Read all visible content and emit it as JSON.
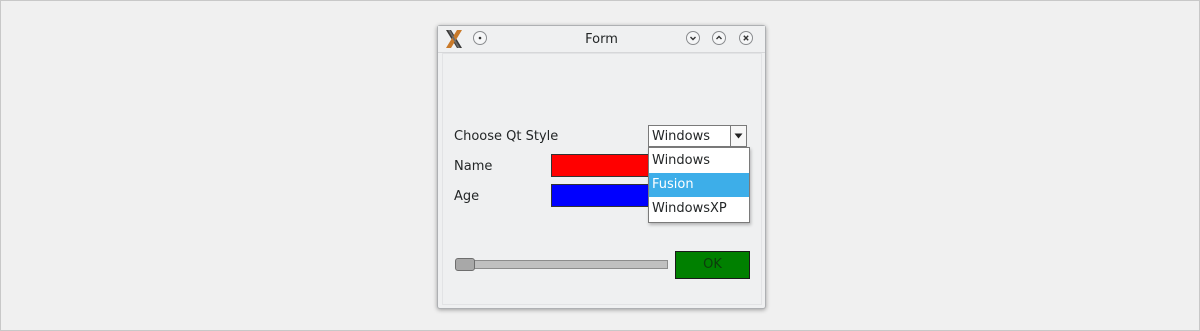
{
  "window": {
    "title": "Form"
  },
  "form": {
    "style_label": "Choose Qt Style",
    "style_combo": {
      "selected": "Windows",
      "options": [
        "Windows",
        "Fusion",
        "WindowsXP"
      ],
      "highlighted": "Fusion"
    },
    "name_label": "Name",
    "age_label": "Age",
    "name_field_color": "#ff0000",
    "age_field_color": "#0000ff",
    "slider_value_percent": 0,
    "ok_label": "OK",
    "ok_color": "#008000"
  },
  "icons": {
    "app": "x-app-icon",
    "menu": "window-menu-icon",
    "minimize": "chevron-down-icon",
    "maximize": "chevron-up-icon",
    "close": "close-icon",
    "combo_arrow": "triangle-down-icon"
  },
  "colors": {
    "highlight": "#3daee9"
  }
}
